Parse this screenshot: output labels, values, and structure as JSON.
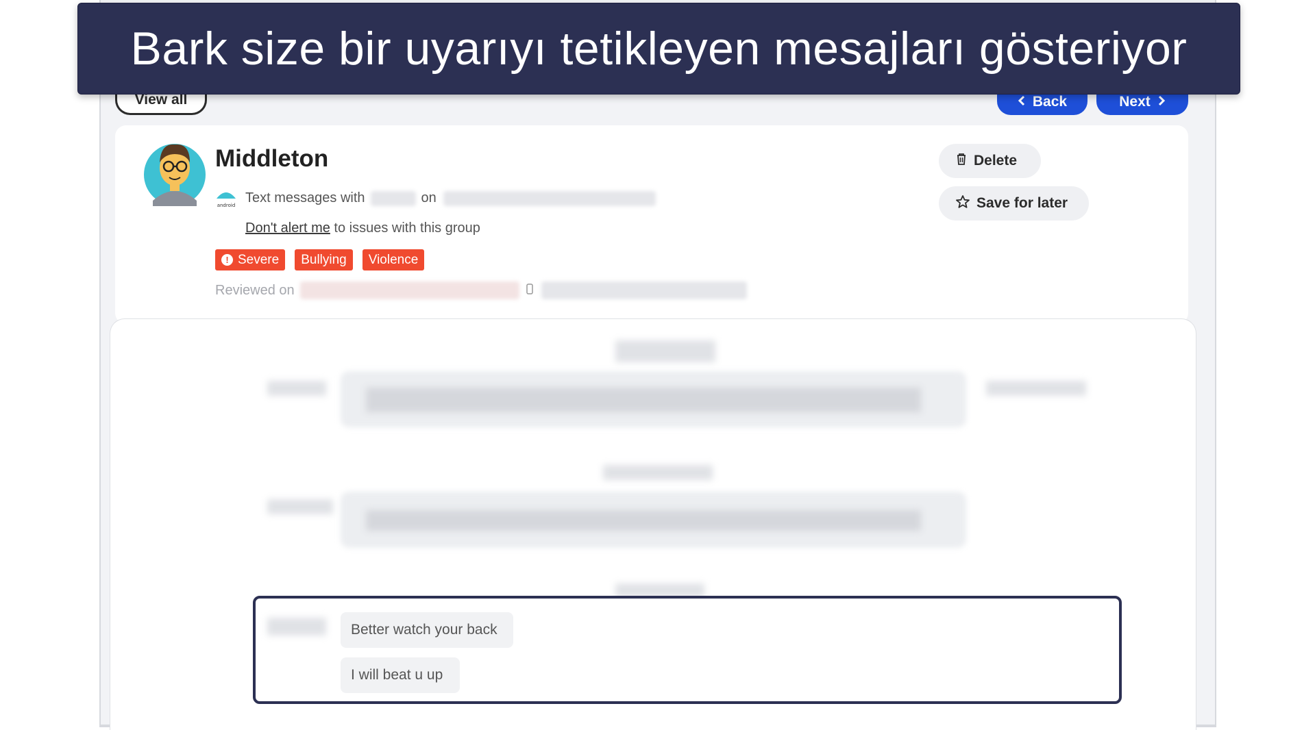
{
  "banner": {
    "text": "Bark size bir uyarıyı tetikleyen mesajları gösteriyor"
  },
  "toolbar": {
    "view_all_label": "View all",
    "back_label": "Back",
    "next_label": "Next"
  },
  "alert": {
    "contact_name": "Middleton",
    "platform_icon": "android-icon",
    "platform_label": "android",
    "source_prefix": "Text messages with",
    "source_on": "on",
    "dont_alert_link": "Don't alert me",
    "dont_alert_rest": " to issues with this group",
    "tags": [
      {
        "label": "Severe",
        "icon": "alert-icon"
      },
      {
        "label": "Bullying"
      },
      {
        "label": "Violence"
      }
    ],
    "reviewed_label": "Reviewed on"
  },
  "actions": {
    "delete_label": "Delete",
    "save_label": "Save for later"
  },
  "messages": {
    "flagged": [
      "Better watch your back",
      "I will beat u up"
    ]
  },
  "colors": {
    "banner": "#2c3053",
    "primary_button": "#1e4fd8",
    "tag": "#f04a2f",
    "highlight_border": "#2c3053"
  }
}
